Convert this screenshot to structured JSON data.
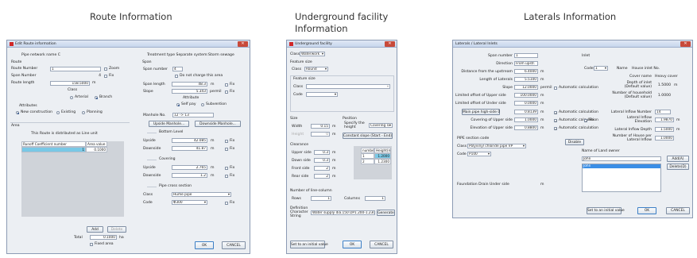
{
  "captions": {
    "route": "Route Information",
    "underground_line1": "Underground facility",
    "underground_line2": "Information",
    "laterals": "Laterals Information"
  },
  "route": {
    "title": "Edit Route information",
    "pipe_network_name": "Pipe network name  C",
    "treatment_type": "Treatment type  Separate system:Storm sewage",
    "route_label": "Route",
    "route_number_label": "Route Number",
    "route_number": "1",
    "zoom": "Zoom",
    "span_number_label": "Span Number",
    "span_number": "4",
    "fix": "Fix",
    "route_length_label": "Route length",
    "route_length": "158.5000",
    "route_length_unit": "m",
    "class_label": "Class",
    "arterial": "Arterial",
    "branch": "Branch",
    "attributes_label": "Attributes",
    "new_construction": "New construction",
    "existing": "Existing",
    "planning": "Planning",
    "area_label": "Area",
    "distributed": "This Route is distributed as   Line unit",
    "col_runoff": "Runoff Coefficient number",
    "col_area": "Area value",
    "row_num": "1",
    "row_area": "0.1000",
    "add": "Add",
    "delete": "Delete",
    "total_label": "Total",
    "total_value": "0.1000",
    "total_unit": "ha",
    "fixed_area": "Fixed area",
    "span_label": "Span",
    "span_number_field_label": "Span number",
    "span_number_value": "4",
    "do_not_charge": "Do not charge this area",
    "span_length_label": "Span length",
    "span_length": "48.3",
    "unit_m": "m",
    "slope_label": "Slope",
    "slope": "5.343",
    "slope_unit": "permil",
    "attribute_label": "Attribute",
    "self_pay": "Self pay",
    "subvention": "Subvention",
    "manhole_no_label": "Manhole No.",
    "manhole_no": "12 -> 13",
    "upside_manhole": "Upside Manhole...",
    "downside_manhole": "Downside Manhole...",
    "bottom_level": "Bottom Level",
    "upside_label": "Upside",
    "bottom_up": "42.085",
    "downside_label": "Downside",
    "bottom_down": "41.87",
    "covering": "Covering",
    "cover_up": "2.765",
    "cover_down": "1.2",
    "pipe_cross_section": "Pipe cross section",
    "class_field_label": "Class",
    "class_value": "Hume pipe",
    "code_label": "Code",
    "code_value": "Φ300",
    "ok": "OK",
    "cancel": "CANCEL"
  },
  "underground": {
    "title": "Underground facility",
    "class_label": "Class",
    "class_value": "Waterwork",
    "feature_size": "Feature size",
    "feature_class": "Class",
    "round": "Round",
    "feature_size2": "Feature size",
    "class2": "Class",
    "code": "Code",
    "size": "Size",
    "width": "Width",
    "width_value": "0.15",
    "height": "Height",
    "height_value": "0",
    "unit_m": "m",
    "position": "Position",
    "specify_line1": "Specify the",
    "specify_line2": "height",
    "covering_sel": "Covering si",
    "constant_slope": "Constant slope (Start - End)",
    "clearance": "Clearance",
    "upper_side": "Upper side",
    "upper_value": "0.3",
    "down_side": "Down side",
    "down_value": "0.3",
    "front_side": "Front side",
    "front_value": "2",
    "rear_side": "Rear side",
    "rear_value": "2",
    "col_number": "number",
    "col_height": "Height(m)",
    "row1_n": "1",
    "row1_h": "1.2000",
    "row2_n": "2",
    "row2_h": "1.2300",
    "line_column": "Number of line-column",
    "rows": "Rows",
    "rows_value": "1",
    "columns": "Columns",
    "columns_value": "1",
    "def_line1": "Definition",
    "def_line2": "Character",
    "def_line3": "String",
    "def_value": "Water supply dia.150 DP1.200-1.230",
    "generate": "Generate",
    "initial": "Set to an initial value",
    "ok": "OK",
    "cancel": "CANCEL"
  },
  "laterals": {
    "title": "Laterals / Lateral Inlets",
    "span_number_label": "Span number",
    "span_number": "1",
    "direction_label": "Direction",
    "direction_value": "From upstr.",
    "distance_label": "Distance from the upstream",
    "distance_value": "6.4000",
    "unit_m": "m",
    "length_label": "Length of Laterals",
    "length_value": "5.5100",
    "slope_label": "Slope",
    "slope_value": "12.0000",
    "slope_unit": "permil",
    "auto_calc": "Automatic calculation",
    "limit_upper_label": "Limited offset of Upper side",
    "limit_upper_value": "100.0000",
    "limit_under_label": "Limited offset of Under side",
    "limit_under_value": "0.0000",
    "main_pipe_btn": "Main pipe high-side 0",
    "main_pipe_value": "0.8139",
    "covering_upper_label": "Covering of Upper side",
    "covering_upper_value": "1.0000",
    "elevation_upper_label": "Elevation of Upper side",
    "elevation_upper_value": "0.8800",
    "pipe_section_code": "PIPE section code",
    "pipe_class_label": "Class",
    "pipe_class_value": "Polyvinyl chloride pipe VP",
    "pipe_code_label": "Code",
    "pipe_code_value": "P100",
    "disable": "Disable",
    "foundation": "Foundation Drain Under side",
    "foundation_unit": "m",
    "inlet": "Inlet",
    "inlet_code_label": "Code",
    "inlet_code_value": "1",
    "name_label": "Name",
    "name_value": "House inlet No.",
    "cover_name_label": "Cover name",
    "cover_name_value": "Heavy cover",
    "depth_line1": "Depth of inlet",
    "depth_line2": "(Default value)",
    "depth_value": "1.5000",
    "household_line1": "Number of household",
    "household_line2": "(Default value)",
    "household_value": "1.0000",
    "lateral_inflow_no_label": "Lateral Inflow Number",
    "lateral_inflow_no": "14",
    "fix": "Fix",
    "inflow_elev_line1": "Lateral Inflow",
    "inflow_elev_line2": "Elevation",
    "inflow_elev_value": "1.9870",
    "inflow_depth_label": "Lateral Inflow Depth",
    "inflow_depth_value": "1.5000",
    "house_line1": "Number of House per",
    "house_line2": "Lateral Inflow",
    "house_value": "1.0000",
    "land_owner_label": "Name of Land owner",
    "land_owner_value": "John",
    "list_item": "John",
    "add": "Add(A)",
    "delete": "Delete(D)",
    "initial": "Set to an initial value",
    "ok": "OK",
    "cancel": "CANCEL"
  }
}
